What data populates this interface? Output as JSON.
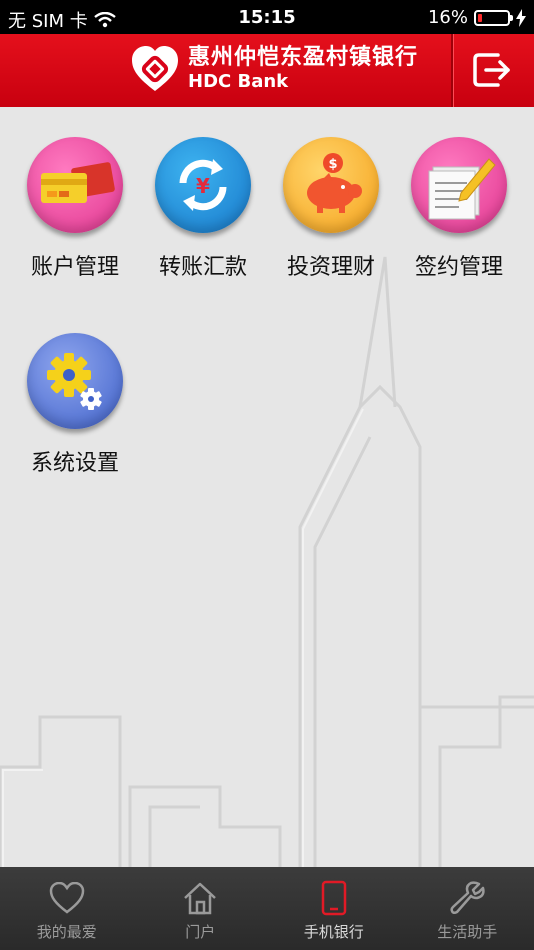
{
  "status_bar": {
    "carrier": "无 SIM 卡",
    "time": "15:15",
    "battery_percent": "16%",
    "battery_level": 0.16
  },
  "header": {
    "bank_name_cn": "惠州仲恺东盈村镇银行",
    "bank_name_en": "HDC Bank"
  },
  "menu": [
    {
      "label": "账户管理",
      "icon": "bank-card-icon"
    },
    {
      "label": "转账汇款",
      "icon": "transfer-icon"
    },
    {
      "label": "投资理财",
      "icon": "piggy-bank-icon"
    },
    {
      "label": "签约管理",
      "icon": "contract-icon"
    },
    {
      "label": "系统设置",
      "icon": "settings-icon"
    }
  ],
  "tabs": [
    {
      "label": "我的最爱",
      "icon": "heart-icon",
      "active": false
    },
    {
      "label": "门户",
      "icon": "home-icon",
      "active": false
    },
    {
      "label": "手机银行",
      "icon": "phone-icon",
      "active": true
    },
    {
      "label": "生活助手",
      "icon": "wrench-icon",
      "active": false
    }
  ],
  "colors": {
    "brand_red": "#d9031a",
    "background": "#e6e6e6",
    "tabbar": "#333333"
  }
}
